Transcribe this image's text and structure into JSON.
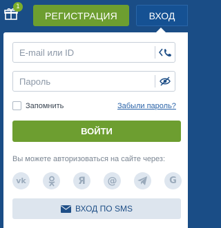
{
  "header": {
    "gift_badge": "1",
    "register_label": "РЕГИСТРАЦИЯ",
    "login_label": "ВХОД"
  },
  "login_form": {
    "email_placeholder": "E-mail или ID",
    "password_placeholder": "Пароль",
    "remember_label": "Запомнить",
    "forgot_label": "Забыли пароль?",
    "submit_label": "ВОЙТИ",
    "social_label": "Вы можете авторизоваться на сайте через:",
    "social_icons": [
      "vk-icon",
      "odnoklassniki-icon",
      "yandex-icon",
      "mail-at-icon",
      "telegram-icon",
      "google-icon"
    ],
    "social_glyphs": {
      "vk": "vk",
      "yandex": "Я",
      "mail": "@",
      "google": "G"
    },
    "sms_label": "ВХОД ПО SMS"
  },
  "colors": {
    "header_bg": "#1a4d86",
    "accent_green": "#6d9e30",
    "link_blue": "#2a63a8",
    "social_bg": "#dee6ef"
  }
}
